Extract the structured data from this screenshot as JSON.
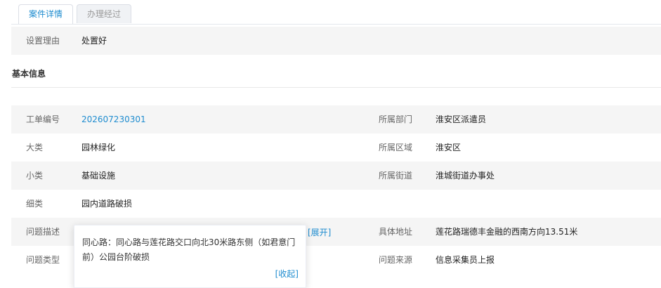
{
  "tabs": [
    {
      "label": "案件详情",
      "active": true
    },
    {
      "label": "办理经过",
      "active": false
    }
  ],
  "reason": {
    "label": "设置理由",
    "value": "处置好"
  },
  "section": {
    "title": "基本信息"
  },
  "fields": {
    "order_no": {
      "label": "工单编号",
      "value": "202607230301"
    },
    "dept": {
      "label": "所属部门",
      "value": "淮安区派遣员"
    },
    "category": {
      "label": "大类",
      "value": "园林绿化"
    },
    "district": {
      "label": "所属区域",
      "value": "淮安区"
    },
    "subcategory": {
      "label": "小类",
      "value": "基础设施"
    },
    "street": {
      "label": "所属街道",
      "value": "淮城街道办事处"
    },
    "detail": {
      "label": "细类",
      "value": "园内道路破损"
    },
    "description": {
      "label": "问题描述",
      "expand": "[展开]"
    },
    "address": {
      "label": "具体地址",
      "value": "莲花路瑞德丰金融的西南方向13.51米"
    },
    "problem_type": {
      "label": "问题类型"
    },
    "source": {
      "label": "问题来源",
      "value": "信息采集员上报"
    }
  },
  "popover": {
    "text": "同心路：同心路与莲花路交口向北30米路东侧（如君意门前）公园台阶破损",
    "collapse": "[收起]"
  },
  "colors": {
    "accent": "#1e8ccf",
    "row_shade": "#f5f5f5"
  }
}
